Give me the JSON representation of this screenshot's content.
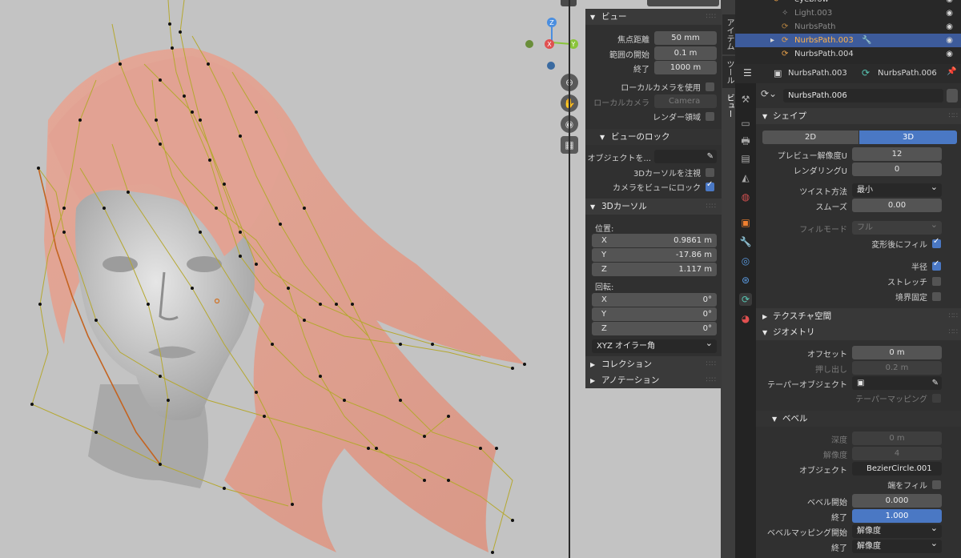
{
  "outliner": {
    "items": [
      {
        "name": "eyebrow",
        "dim": false
      },
      {
        "name": "Light.003",
        "dim": true
      },
      {
        "name": "NurbsPath",
        "dim": true
      },
      {
        "name": "NurbsPath.003",
        "dim": false,
        "selected": true
      },
      {
        "name": "NurbsPath.004",
        "dim": false
      }
    ]
  },
  "viewport": {
    "gizmo": {
      "z": "Z",
      "x": "X",
      "y": "Y"
    },
    "tabs": [
      "アイテム",
      "ツール",
      "ビュー"
    ]
  },
  "npanel": {
    "view": {
      "header": "ビュー",
      "focal_label": "焦点距離",
      "focal_value": "50 mm",
      "clip_start_label": "範囲の開始",
      "clip_start_value": "0.1 m",
      "clip_end_label": "終了",
      "clip_end_value": "1000 m",
      "local_camera_use": "ローカルカメラを使用",
      "local_camera_label": "ローカルカメラ",
      "local_camera_value": "Camera",
      "render_region": "レンダー領域"
    },
    "view_lock": {
      "header": "ビューのロック",
      "object_label": "オブジェクトを...",
      "lock_cursor": "3Dカーソルを注視",
      "camera_to_view": "カメラをビューにロック"
    },
    "cursor": {
      "header": "3Dカーソル",
      "location_label": "位置:",
      "x_label": "X",
      "x_value": "0.9861 m",
      "y_label": "Y",
      "y_value": "-17.86 m",
      "z_label": "Z",
      "z_value": "1.117 m",
      "rotation_label": "回転:",
      "rx_value": "0°",
      "ry_value": "0°",
      "rz_value": "0°",
      "mode_value": "XYZ オイラー角"
    },
    "collection_header": "コレクション",
    "annotation_header": "アノテーション"
  },
  "properties": {
    "header": {
      "object": "NurbsPath.003",
      "data": "NurbsPath.006"
    },
    "datablock": "NurbsPath.006",
    "shape": {
      "header": "シェイプ",
      "btn_2d": "2D",
      "btn_3d": "3D",
      "preview_u_label": "プレビュー解像度U",
      "preview_u_value": "12",
      "render_u_label": "レンダリングU",
      "render_u_value": "0",
      "twist_label": "ツイスト方法",
      "twist_value": "最小",
      "smooth_label": "スムーズ",
      "smooth_value": "0.00",
      "fill_mode_label": "フィルモード",
      "fill_mode_value": "フル",
      "fill_deform_label": "変形後にフィル",
      "radius_label": "半径",
      "stretch_label": "ストレッチ",
      "bounds_label": "境界固定"
    },
    "texture_space_header": "テクスチャ空間",
    "geometry": {
      "header": "ジオメトリ",
      "offset_label": "オフセット",
      "offset_value": "0 m",
      "extrude_label": "押し出し",
      "extrude_value": "0.2 m",
      "taper_label": "テーパーオブジェクト",
      "taper_map_label": "テーパーマッピング"
    },
    "bevel": {
      "header": "ベベル",
      "depth_label": "深度",
      "depth_value": "0 m",
      "resolution_label": "解像度",
      "resolution_value": "4",
      "object_label": "オブジェクト",
      "object_value": "BezierCircle.001",
      "fill_caps_label": "端をフィル",
      "start_label": "ベベル開始",
      "start_value": "0.000",
      "end_label": "終了",
      "end_value": "1.000",
      "map_start_label": "ベベルマッピング開始",
      "map_start_value": "解像度",
      "map_end_label": "終了",
      "map_end_value": "解像度"
    }
  }
}
